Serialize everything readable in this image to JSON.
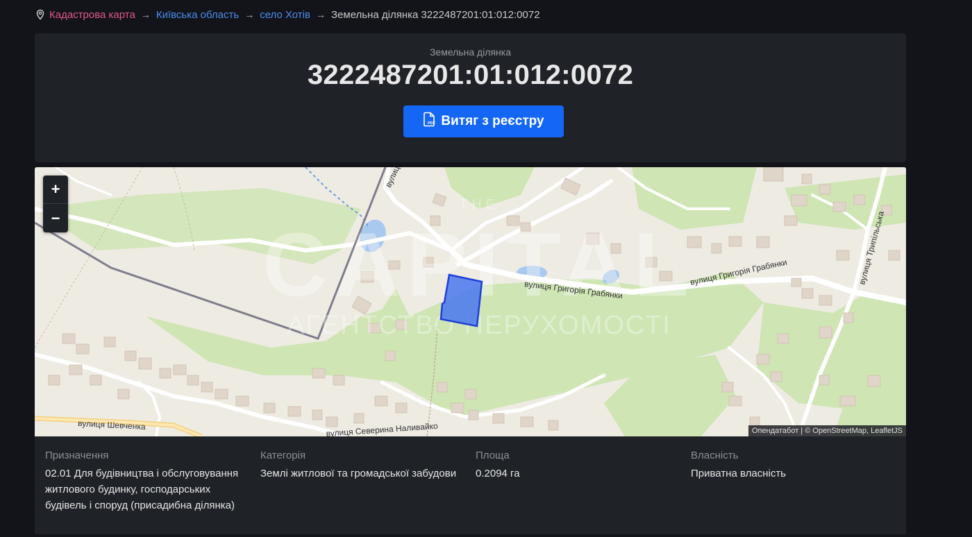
{
  "breadcrumb": {
    "items": [
      {
        "label": "Кадастрова карта"
      },
      {
        "label": "Київська область"
      },
      {
        "label": "село Хотів"
      }
    ],
    "current": "Земельна ділянка 3222487201:01:012:0072"
  },
  "header": {
    "subtitle": "Земельна ділянка",
    "title": "3222487201:01:012:0072",
    "button_label": "Витяг з реєстру"
  },
  "map": {
    "zoom_in": "+",
    "zoom_out": "−",
    "attribution": "Опендатабот | © OpenStreetMap, LeafletJS",
    "streets": {
      "hrabianky_1": "вулиця Григорія Грабянки",
      "hrabianky_2": "вулиця Григорія Грабянки",
      "shevchenka": "вулиця Шевченка",
      "nalyvaika": "вулиця Северина Наливайко",
      "trypilska": "вулиця Трипільська",
      "top": "вулиця"
    },
    "watermark": {
      "brand": "CAPITAL",
      "sub": "АГЕНТСТВО НЕРУХОМОСТІ",
      "top": "THE"
    },
    "colors": {
      "parcel_fill": "#4a78f0",
      "parcel_stroke": "#1e3fd9",
      "green": "#cfe5b4",
      "water": "#a9c9ee"
    }
  },
  "info": {
    "columns": [
      {
        "label": "Призначення",
        "value": "02.01 Для будівництва і обслуговування житлового будинку, господарських будівель і споруд (присадибна ділянка)"
      },
      {
        "label": "Категорія",
        "value": "Землі житлової та громадської забудови"
      },
      {
        "label": "Площа",
        "value": "0.2094 га"
      },
      {
        "label": "Власність",
        "value": "Приватна власність"
      }
    ]
  }
}
